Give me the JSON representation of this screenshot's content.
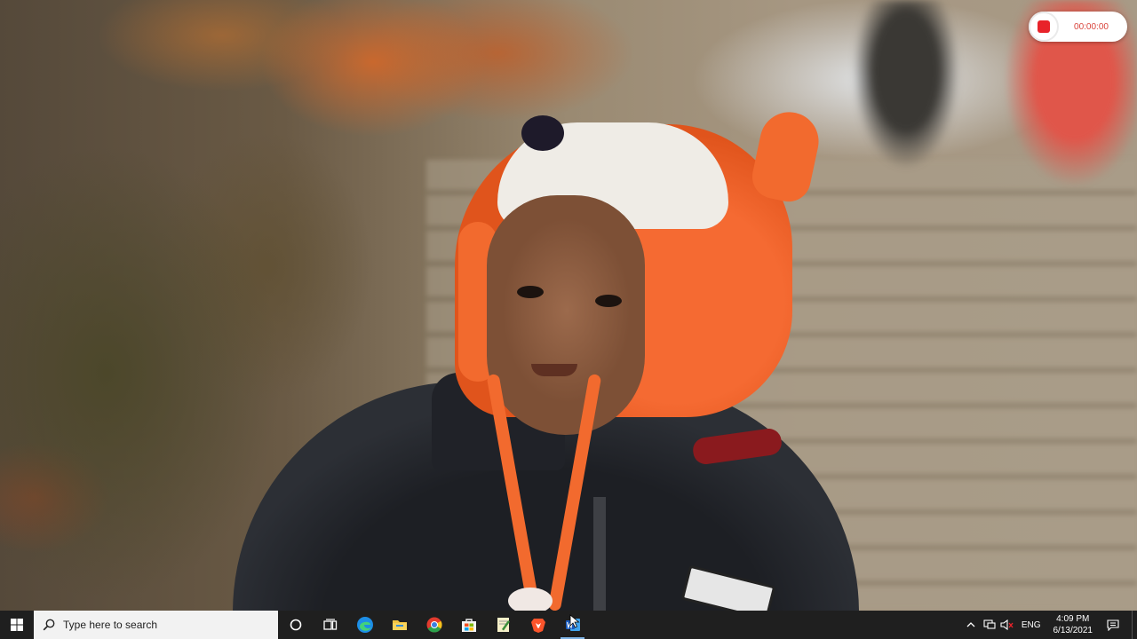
{
  "recorder": {
    "time": "00:00:00",
    "stop_color": "#e8232a"
  },
  "taskbar": {
    "start_icon": "windows-logo-icon",
    "search_placeholder": "Type here to search",
    "search_icon": "search-icon",
    "pinned": [
      {
        "name": "cortana-icon"
      },
      {
        "name": "task-view-icon"
      },
      {
        "name": "edge-icon"
      },
      {
        "name": "file-explorer-icon"
      },
      {
        "name": "chrome-icon"
      },
      {
        "name": "microsoft-store-icon"
      },
      {
        "name": "notepad-icon"
      },
      {
        "name": "brave-icon"
      },
      {
        "name": "word-icon",
        "active": true
      }
    ],
    "tray": {
      "language": "ENG",
      "time": "4:09 PM",
      "date": "6/13/2021"
    }
  }
}
